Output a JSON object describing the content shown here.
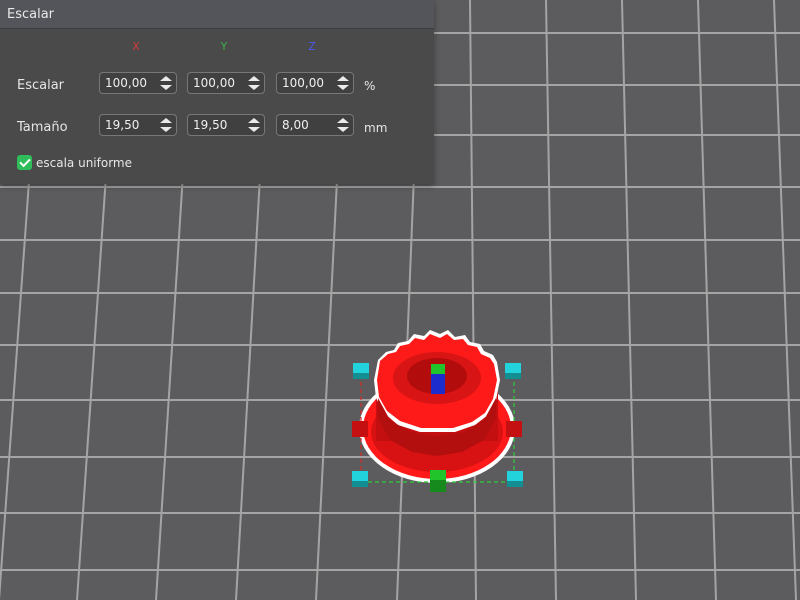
{
  "panel": {
    "title": "Escalar",
    "axes": {
      "x": "X",
      "y": "Y",
      "z": "Z"
    },
    "scale_row": {
      "label": "Escalar",
      "x": "100,00",
      "y": "100,00",
      "z": "100,00",
      "unit": "%"
    },
    "size_row": {
      "label": "Tamaño",
      "x": "19,50",
      "y": "19,50",
      "z": "8,00",
      "unit": "mm"
    },
    "uniform": {
      "label": "escala uniforme",
      "checked": true
    }
  },
  "colors": {
    "axis_x": "#d23a3a",
    "axis_y": "#3bb04a",
    "axis_z": "#4b5ce8",
    "model": "#ff1a1a",
    "checkbox": "#2ebd5a",
    "handle_corner": "#22d3dc",
    "viewport_bg": "#5c5c5e",
    "grid": "#9c9c9c"
  }
}
